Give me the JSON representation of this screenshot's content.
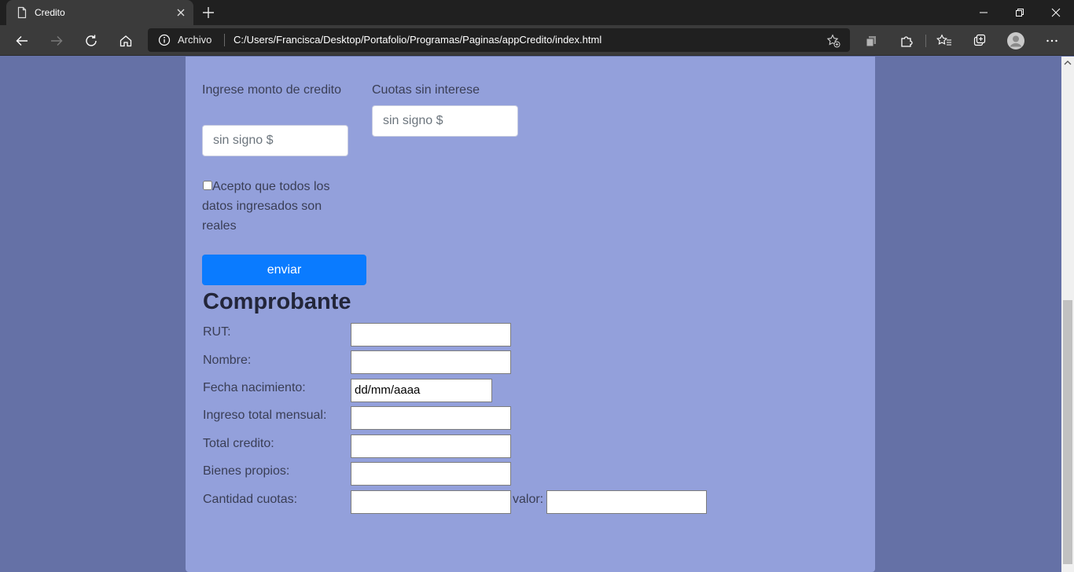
{
  "browser": {
    "tab_title": "Credito",
    "address_scheme": "Archivo",
    "url": "C:/Users/Francisca/Desktop/Portafolio/Programas/Paginas/appCredito/index.html"
  },
  "form": {
    "amount_label": "Ingrese monto de credito",
    "amount_placeholder": "sin signo $",
    "installments_label": "Cuotas sin interese",
    "installments_placeholder": "sin signo $",
    "accept_label": "Acepto que todos los datos ingresados son reales",
    "accept_checked": false,
    "submit_label": "enviar"
  },
  "receipt": {
    "heading": "Comprobante",
    "rut_label": "RUT:",
    "nombre_label": "Nombre:",
    "fecha_label": "Fecha nacimiento:",
    "fecha_value": "dd/mm/aaaa",
    "ingreso_label": "Ingreso total mensual:",
    "total_label": "Total credito:",
    "bienes_label": "Bienes propios:",
    "cuotas_label": "Cantidad cuotas:",
    "valor_label": "valor:"
  },
  "colors": {
    "page_background": "#6571a6",
    "container_background": "#93a0db",
    "button_primary": "#0a7bff"
  }
}
